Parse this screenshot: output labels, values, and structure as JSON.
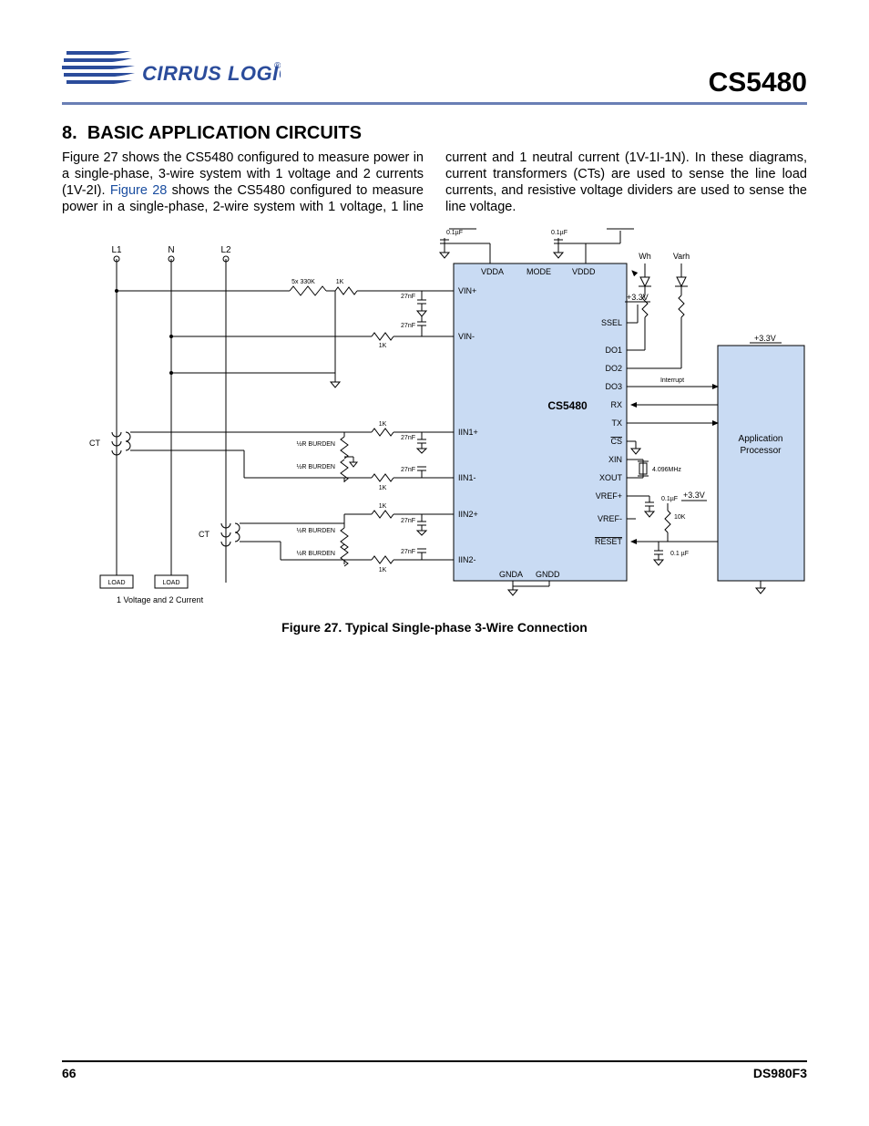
{
  "header": {
    "logo_text": "CIRRUS LOGIC",
    "logo_suffix": "®",
    "part_number": "CS5480"
  },
  "section": {
    "number": "8.",
    "title": "BASIC APPLICATION CIRCUITS"
  },
  "body": {
    "p1a": "Figure 27 shows the CS5480 configured to measure power in a single-phase, 3-wire system with 1 voltage and 2 currents (1V-2I). ",
    "p1_link": "Figure 28",
    "p1b": " shows the CS5480 configured to measure power in a single-phase, 2-wire ",
    "p2": "system with 1 voltage, 1 line current and 1 neutral current (1V-1I-1N). In these diagrams, current transformers (CTs) are used to sense the line load currents, and resistive voltage dividers are used to sense the line voltage."
  },
  "figure": {
    "caption": "Figure 27.  Typical Single-phase 3-Wire Connection",
    "subtitle": "1 Voltage and 2 Current"
  },
  "diagram": {
    "phase_L1": "L1",
    "phase_N": "N",
    "phase_L2": "L2",
    "ct": "CT",
    "load": "LOAD",
    "chip": {
      "name": "CS5480",
      "pins_left": [
        "VIN+",
        "VIN-",
        "IIN1+",
        "IIN1-",
        "IIN2+",
        "IIN2-"
      ],
      "pins_top": [
        "VDDA",
        "MODE",
        "VDDD"
      ],
      "pins_right": [
        "SSEL",
        "DO1",
        "DO2",
        "DO3",
        "RX",
        "TX",
        "CS",
        "XIN",
        "XOUT",
        "VREF+",
        "VREF-",
        "RESET"
      ],
      "pins_bottom": [
        "GNDA",
        "GNDD"
      ]
    },
    "app_proc": "Application\nProcessor",
    "supply": "+3.3V",
    "caps": {
      "c01uF": "0.1µF",
      "c01_uF": "0.1 µF",
      "c27nF": "27nF"
    },
    "res": {
      "r1k": "1K",
      "r5x330k": "5x 330K",
      "r10k": "10K",
      "rburden": "½R BURDEN"
    },
    "labels": {
      "wh": "Wh",
      "varh": "Varh",
      "interrupt": "Interrupt",
      "xtal": "4.096MHz"
    },
    "overline_cs": "CS",
    "overline_reset": "RESET"
  },
  "footer": {
    "page": "66",
    "doc": "DS980F3"
  }
}
